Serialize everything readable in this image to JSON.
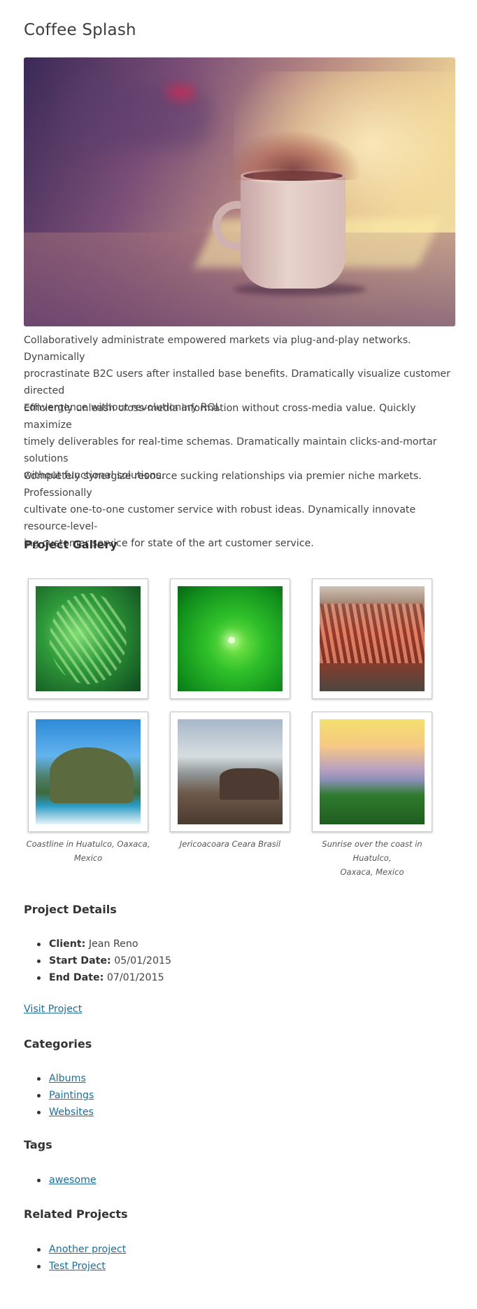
{
  "page": {
    "title": "Coffee Splash"
  },
  "hero": {
    "alt": "coffee-splash-photo"
  },
  "paragraphs": [
    {
      "l1": "Collaboratively administrate empowered markets via plug-and-play networks. Dynamically",
      "l2": "procrastinate B2C users after installed base benefits. Dramatically visualize customer directed",
      "l3": "convergence without revolutionary ROI."
    },
    {
      "l1": "Efficiently unleash cross-media information without cross-media value. Quickly maximize",
      "l2": "timely deliverables for real-time schemas. Dramatically maintain clicks-and-mortar solutions",
      "l3": "without functional solutions."
    },
    {
      "l1": "Completely synergize resource sucking relationships via premier niche markets. Professionally",
      "l2": "cultivate one-to-one customer service with robust ideas. Dynamically innovate resource-level-",
      "l3": "ing customer service for state of the art customer service."
    }
  ],
  "gallery": {
    "heading": "Project Gallery",
    "captions": [
      {
        "l1": "Coastline in Huatulco, Oaxaca,",
        "l2": "Mexico"
      },
      {
        "l1": "Jericoacoara Ceara Brasil",
        "l2": ""
      },
      {
        "l1": "Sunrise over the coast in Huatulco,",
        "l2": "Oaxaca, Mexico"
      }
    ]
  },
  "details": {
    "heading": "Project Details",
    "client_label": "Client:",
    "client_value": "Jean Reno",
    "start_label": "Start Date:",
    "start_value": "05/01/2015",
    "end_label": "End Date:",
    "end_value": "07/01/2015",
    "visit_link": "Visit Project"
  },
  "categories": {
    "heading": "Categories",
    "items": [
      "Albums",
      "Paintings",
      "Websites"
    ]
  },
  "tags": {
    "heading": "Tags",
    "items": [
      "awesome"
    ]
  },
  "related": {
    "heading": "Related Projects",
    "items": [
      "Another project",
      "Test Project"
    ]
  },
  "colors": {
    "link": "#1e6e9b",
    "text": "#444444"
  }
}
